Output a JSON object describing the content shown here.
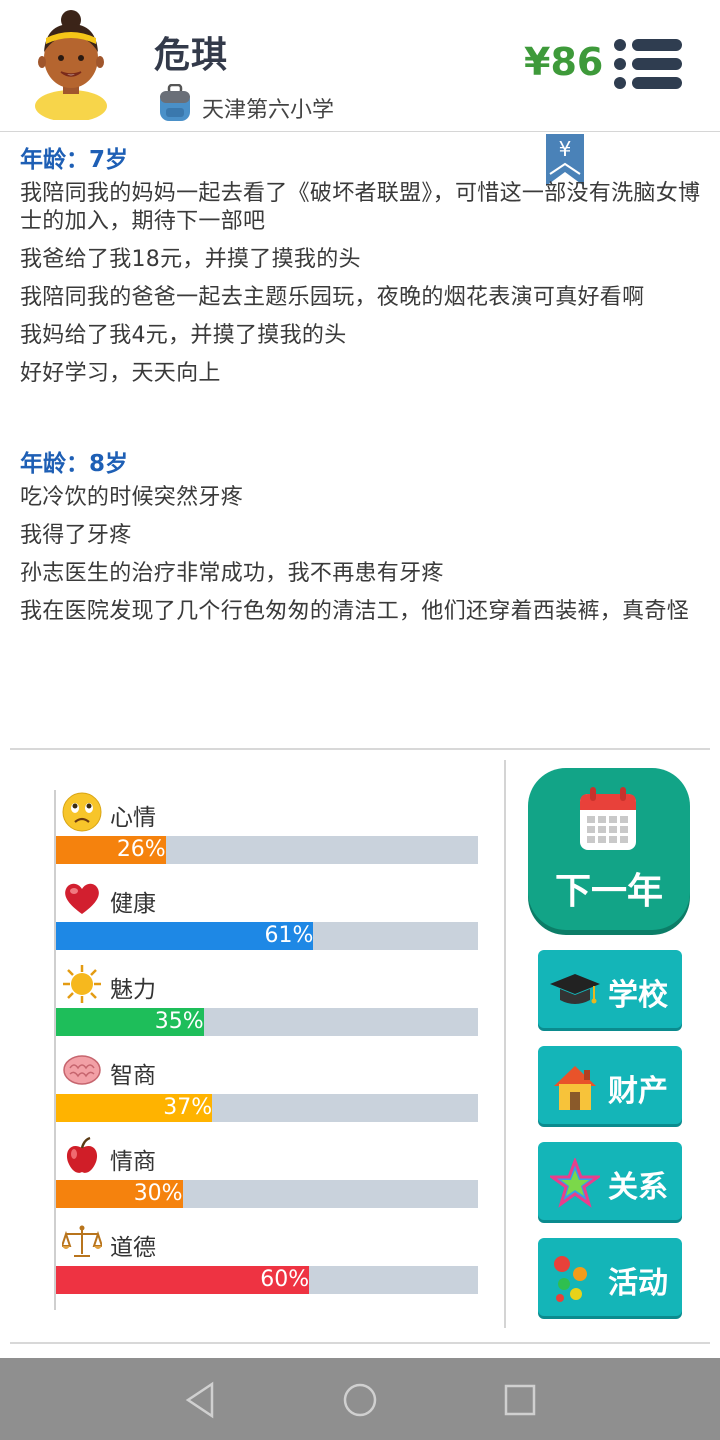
{
  "header": {
    "name": "危琪",
    "school": "天津第六小学",
    "money": "¥86",
    "icons": {
      "avatar": "girl-avatar",
      "school": "backpack-icon",
      "menu": "menu-list-icon",
      "ribbon": "yuan-bookmark-icon"
    },
    "ribbon_symbol": "¥"
  },
  "log": [
    {
      "age": "年龄：7岁",
      "entries": [
        "我陪同我的妈妈一起去看了《破坏者联盟》，可惜这一部没有洗脑女博士的加入，期待下一部吧",
        "我爸给了我18元，并摸了摸我的头",
        "我陪同我的爸爸一起去主题乐园玩，夜晚的烟花表演可真好看啊",
        "我妈给了我4元，并摸了摸我的头",
        "好好学习，天天向上"
      ]
    },
    {
      "age": "年龄：8岁",
      "entries": [
        "吃冷饮的时候突然牙疼",
        "我得了牙疼",
        "孙志医生的治疗非常成功，我不再患有牙疼",
        "我在医院发现了几个行色匆匆的清洁工，他们还穿着西装裤，真奇怪"
      ]
    }
  ],
  "stats": [
    {
      "label": "心情",
      "value": 26,
      "text": "26%",
      "color": "#f5820d",
      "icon": "sad-face-icon"
    },
    {
      "label": "健康",
      "value": 61,
      "text": "61%",
      "color": "#1e88e5",
      "icon": "heart-icon"
    },
    {
      "label": "魅力",
      "value": 35,
      "text": "35%",
      "color": "#1ebe5a",
      "icon": "sun-icon"
    },
    {
      "label": "智商",
      "value": 37,
      "text": "37%",
      "color": "#ffb300",
      "icon": "brain-icon"
    },
    {
      "label": "情商",
      "value": 30,
      "text": "30%",
      "color": "#f5820d",
      "icon": "apple-icon"
    },
    {
      "label": "道德",
      "value": 60,
      "text": "60%",
      "color": "#ee3342",
      "icon": "scales-icon"
    }
  ],
  "actions": {
    "next_year": "下一年",
    "school": "学校",
    "property": "财产",
    "relations": "关系",
    "activities": "活动"
  },
  "colors": {
    "accent_green": "#12a487",
    "button_teal": "#14b5b8",
    "money_green": "#3e9a3a",
    "age_blue": "#1e5fb5"
  }
}
